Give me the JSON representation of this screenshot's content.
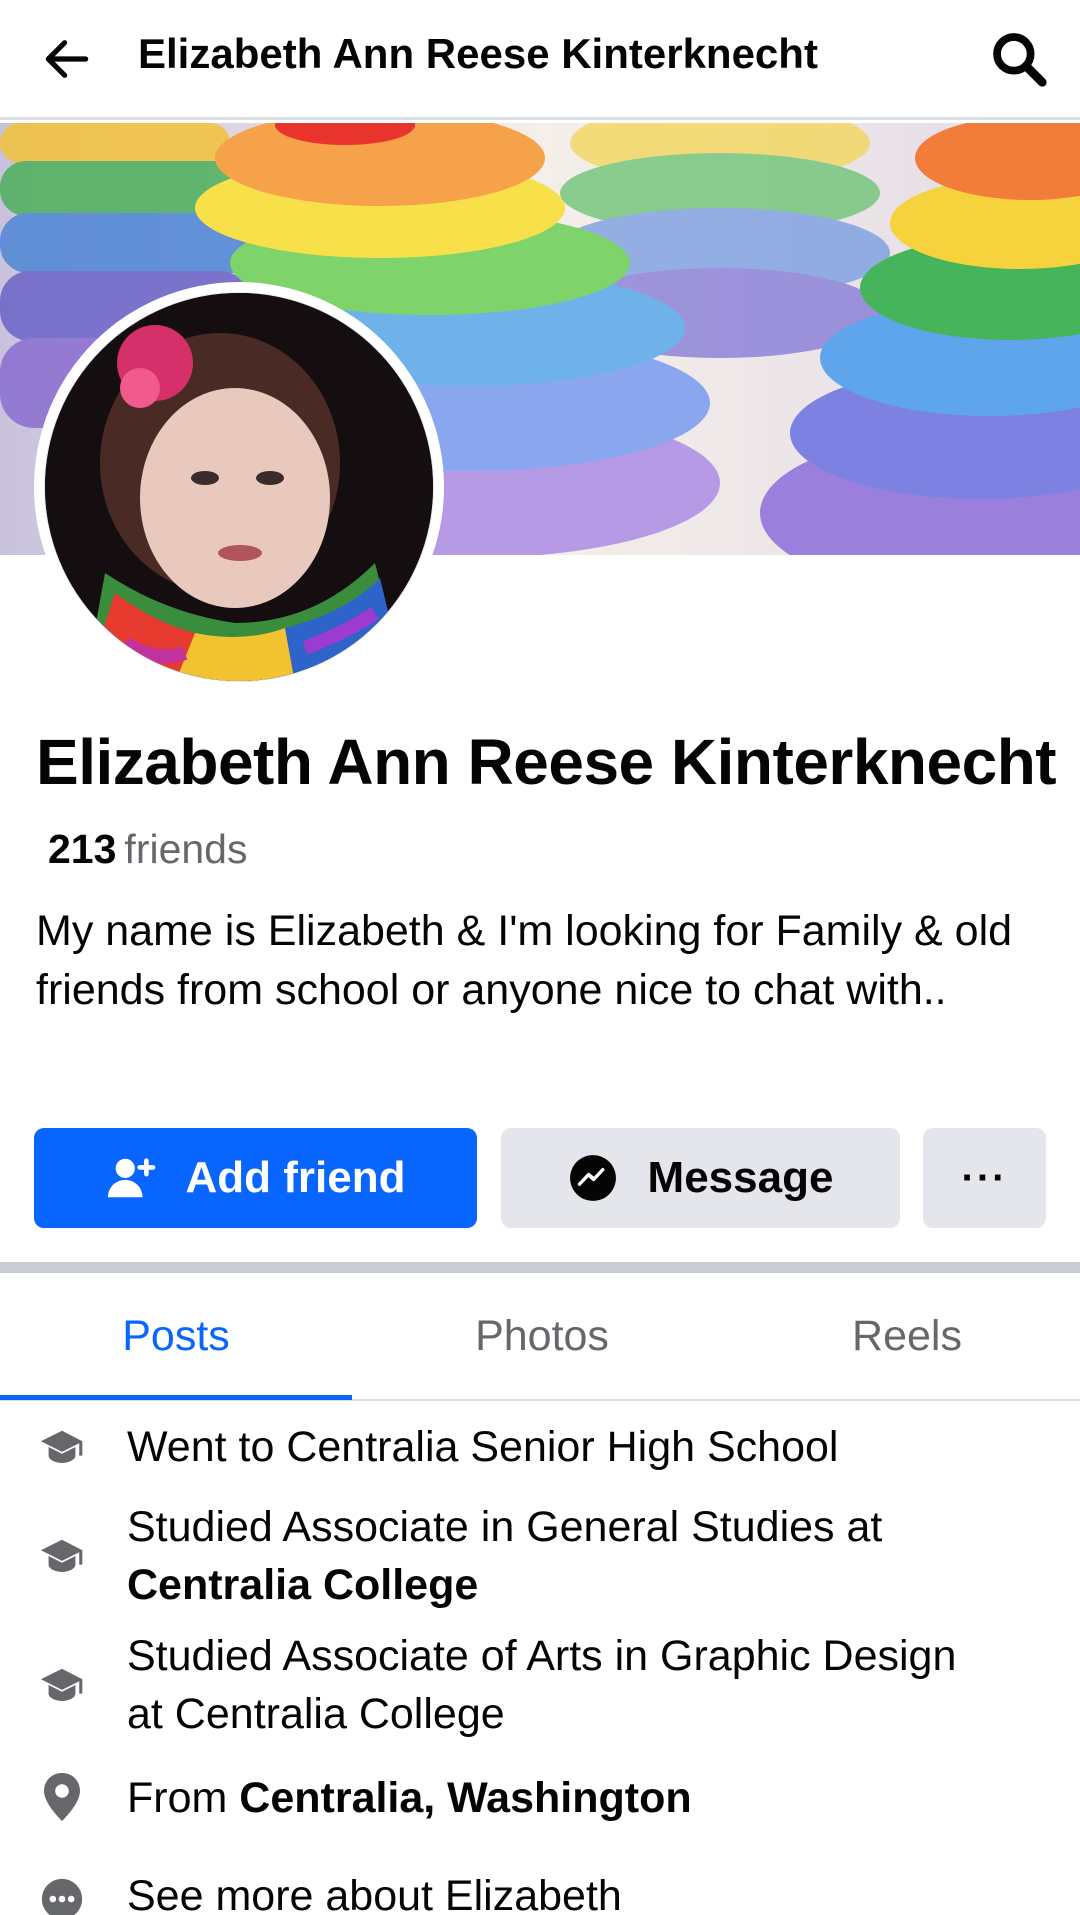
{
  "header": {
    "title": "Elizabeth Ann Reese Kinterknecht"
  },
  "icons": {
    "back": "arrow-left-icon",
    "search": "search-icon",
    "add_friend": "person-plus-icon",
    "message": "messenger-icon",
    "more": "ellipsis-icon",
    "education": "graduation-cap-icon",
    "location": "map-pin-icon",
    "see_more": "ellipsis-circle-icon"
  },
  "colors": {
    "accent": "#0866ff",
    "secondary_button": "#e4e6eb",
    "muted_text": "#65676b"
  },
  "profile": {
    "name": "Elizabeth Ann Reese Kinterknecht",
    "friends_count": "213",
    "friends_label": "friends",
    "bio": "My name is Elizabeth & I'm looking for Family & old friends from school or anyone nice to chat with.."
  },
  "actions": {
    "add_friend": "Add friend",
    "message": "Message",
    "more": "···"
  },
  "tabs": [
    {
      "label": "Posts",
      "active": true
    },
    {
      "label": "Photos",
      "active": false
    },
    {
      "label": "Reels",
      "active": false
    }
  ],
  "intro": {
    "item1": {
      "text": "Went to Centralia Senior High School"
    },
    "item2": {
      "prefix": "Studied Associate in General Studies at",
      "bold": "Centralia College"
    },
    "item3": {
      "line1": "Studied Associate of Arts in Graphic Design",
      "line2": "at Centralia College"
    },
    "item4": {
      "prefix": "From",
      "bold": "Centralia, Washington"
    },
    "item5": {
      "text": "See more about Elizabeth"
    }
  }
}
